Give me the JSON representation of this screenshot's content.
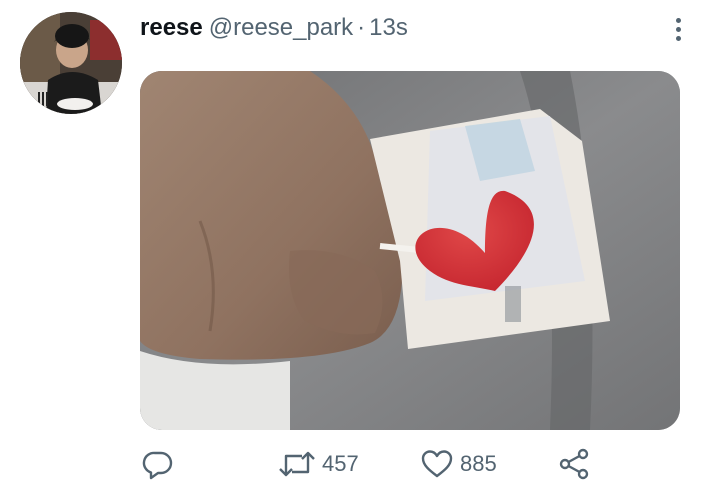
{
  "tweet": {
    "display_name": "reese",
    "handle": "@reese_park",
    "separator": "·",
    "time": "13s",
    "reply": {
      "icon": "reply-icon"
    },
    "retweet": {
      "icon": "retweet-icon",
      "count": "457"
    },
    "like": {
      "icon": "heart-icon",
      "count": "885"
    },
    "share": {
      "icon": "share-icon"
    },
    "more": {
      "icon": "more-vertical-icon"
    }
  },
  "colors": {
    "text_primary": "#0f1419",
    "text_secondary": "#536471",
    "lollipop_red": "#d8303a"
  }
}
